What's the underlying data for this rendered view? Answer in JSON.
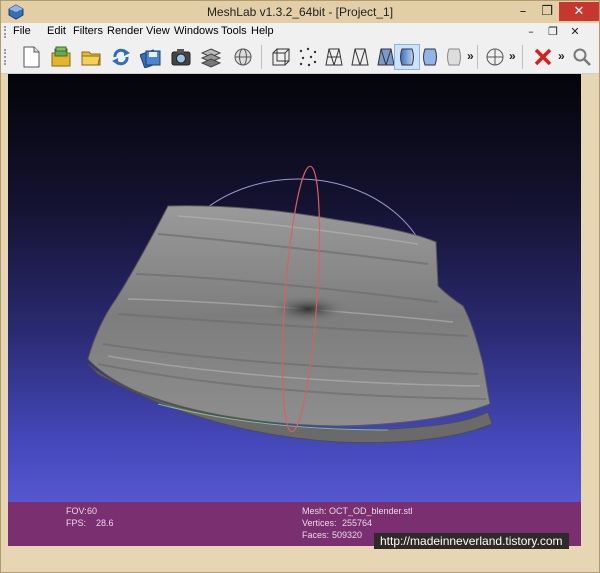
{
  "window": {
    "title": "MeshLab v1.3.2_64bit - [Project_1]"
  },
  "window_controls": {
    "minimize": "–",
    "restore": "❐",
    "close": "✕"
  },
  "mdi_controls": {
    "minimize": "–",
    "restore": "❐",
    "close": "✕"
  },
  "menu": {
    "items": [
      {
        "label": "File"
      },
      {
        "label": "Edit"
      },
      {
        "label": "Filters"
      },
      {
        "label": "Render"
      },
      {
        "label": "View"
      },
      {
        "label": "Windows"
      },
      {
        "label": "Tools"
      },
      {
        "label": "Help"
      }
    ]
  },
  "toolbar": {
    "overflow_label": "»",
    "icons": [
      "new-project-icon",
      "open-project-icon",
      "open-mesh-icon",
      "reload-icon",
      "save-snapshot-icon",
      "camera-icon",
      "layers-icon",
      "globe-icon",
      "bounding-box-icon",
      "points-icon",
      "wireframe-icon",
      "hidden-lines-icon",
      "flat-shading-icon",
      "smooth-shading-icon",
      "texture-icon",
      "trackball-icon",
      "delete-icon",
      "zoom-icon"
    ]
  },
  "info": {
    "fov_label": "FOV:",
    "fov_value": "60",
    "fps_label": "FPS:",
    "fps_value": "28.6",
    "mesh_label": "Mesh:",
    "mesh_value": "OCT_OD_blender.stl",
    "vertices_label": "Vertices:",
    "vertices_value": "255764",
    "faces_label": "Faces:",
    "faces_value": "509320"
  },
  "watermark": "http://madeinneverland.tistory.com",
  "colors": {
    "viewport_top": "#04040a",
    "viewport_bottom": "#5557cf",
    "infobar": "#7a2f70",
    "window_frame": "#e7d6b4",
    "close_button": "#c7372f"
  }
}
